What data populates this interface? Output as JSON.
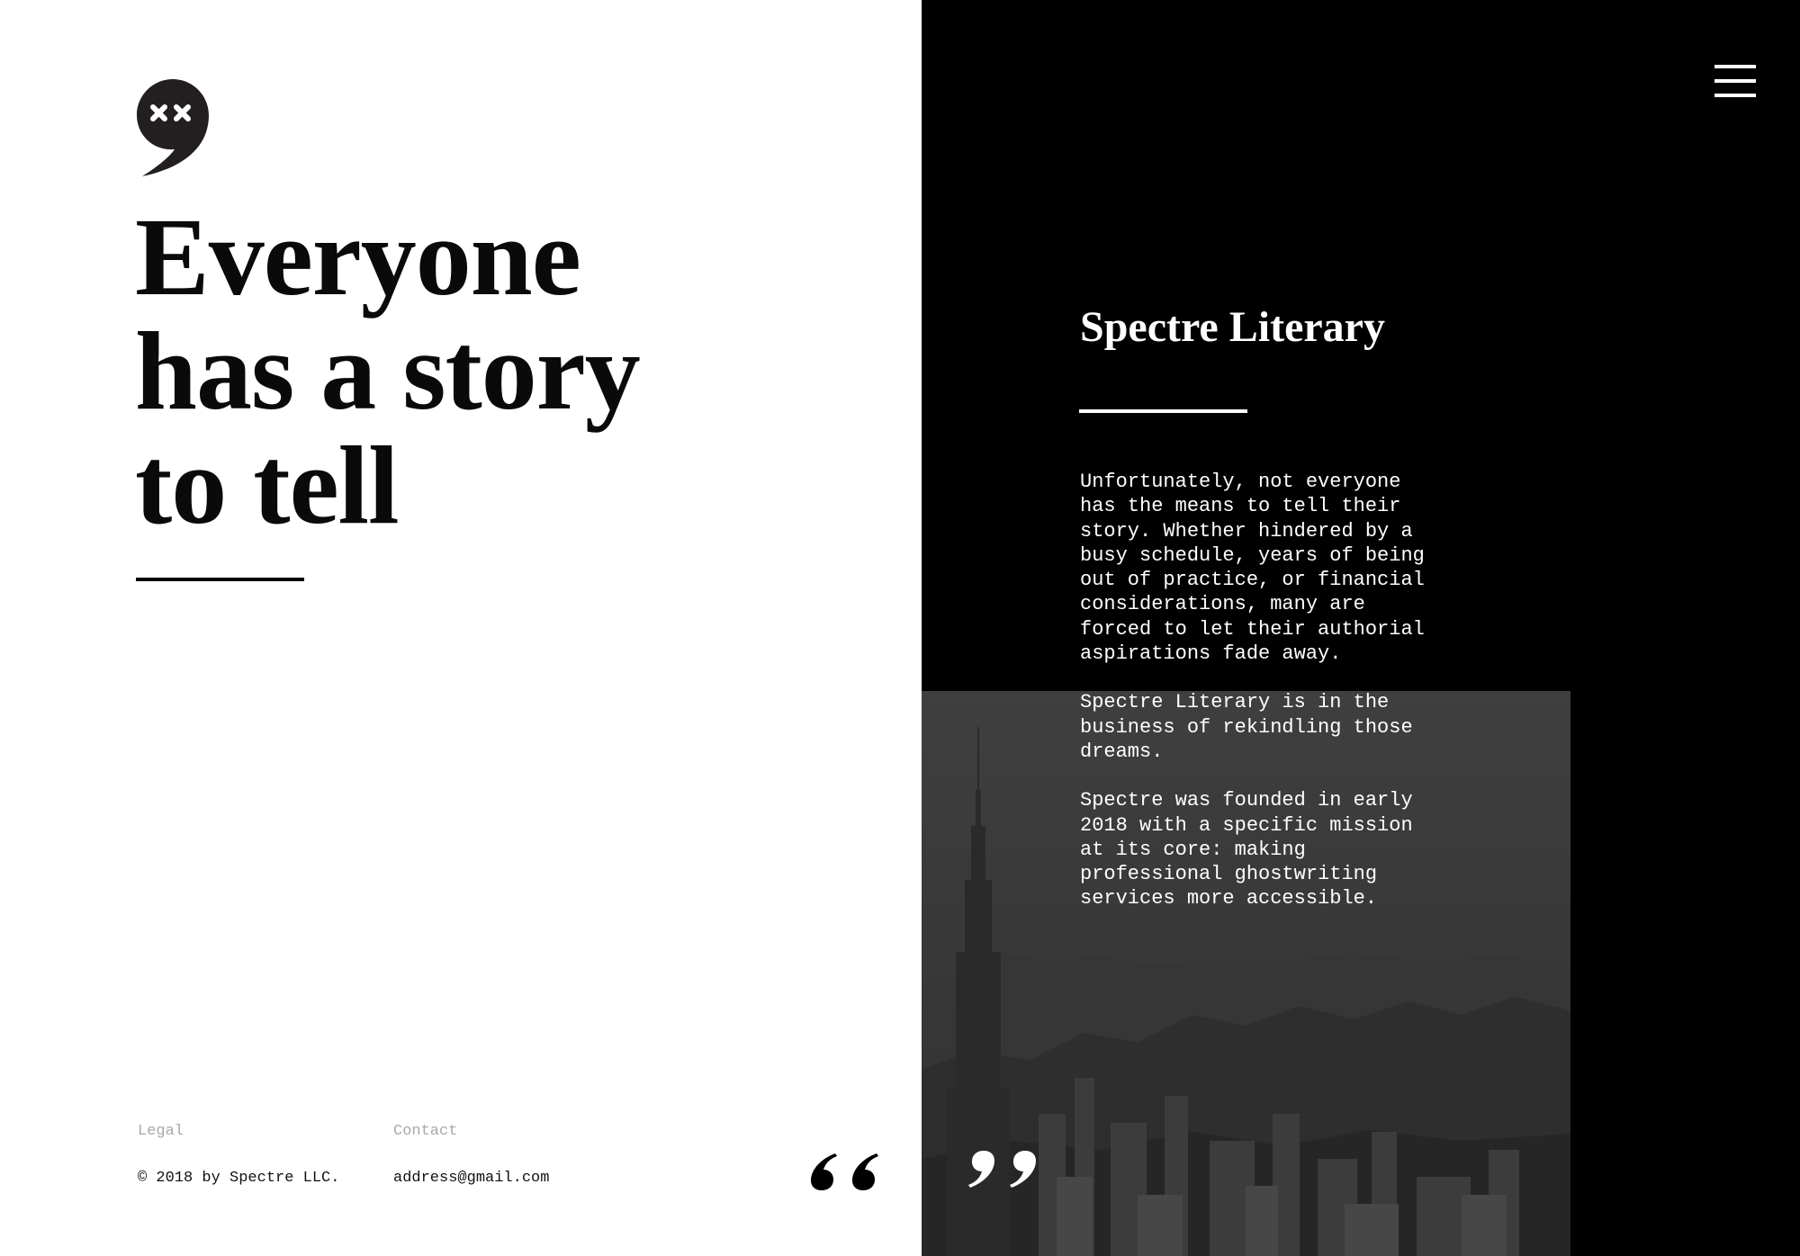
{
  "hero": {
    "headline_lines": [
      "Everyone",
      "has a story",
      "to tell"
    ]
  },
  "brand": {
    "title": "Spectre Literary"
  },
  "about": {
    "paragraphs": [
      "Unfortunately, not everyone\nhas the means to tell their\nstory.  Whether hindered by a\nbusy schedule, years of being\nout of practice, or financial\nconsiderations, many are\nforced to let their authorial\naspirations fade away.",
      "Spectre Literary is in the\nbusiness of rekindling those\ndreams.",
      "Spectre was founded in early\n2018 with a specific mission\nat its core: making\nprofessional ghostwriting\nservices more accessible."
    ]
  },
  "footer": {
    "legal_label": "Legal",
    "contact_label": "Contact",
    "copyright": "© 2018 by Spectre LLC.",
    "email": "address@gmail.com"
  },
  "icons": {
    "logo": "comma-speech-bubble-icon",
    "menu": "hamburger-menu-icon",
    "open_quote": "open-quote-icon",
    "close_quote": "close-quote-icon"
  },
  "colors": {
    "left_background": "#ffffff",
    "right_background": "#000000",
    "photo_tint": "#3a3a3a",
    "footer_label": "#a8a8a8"
  }
}
